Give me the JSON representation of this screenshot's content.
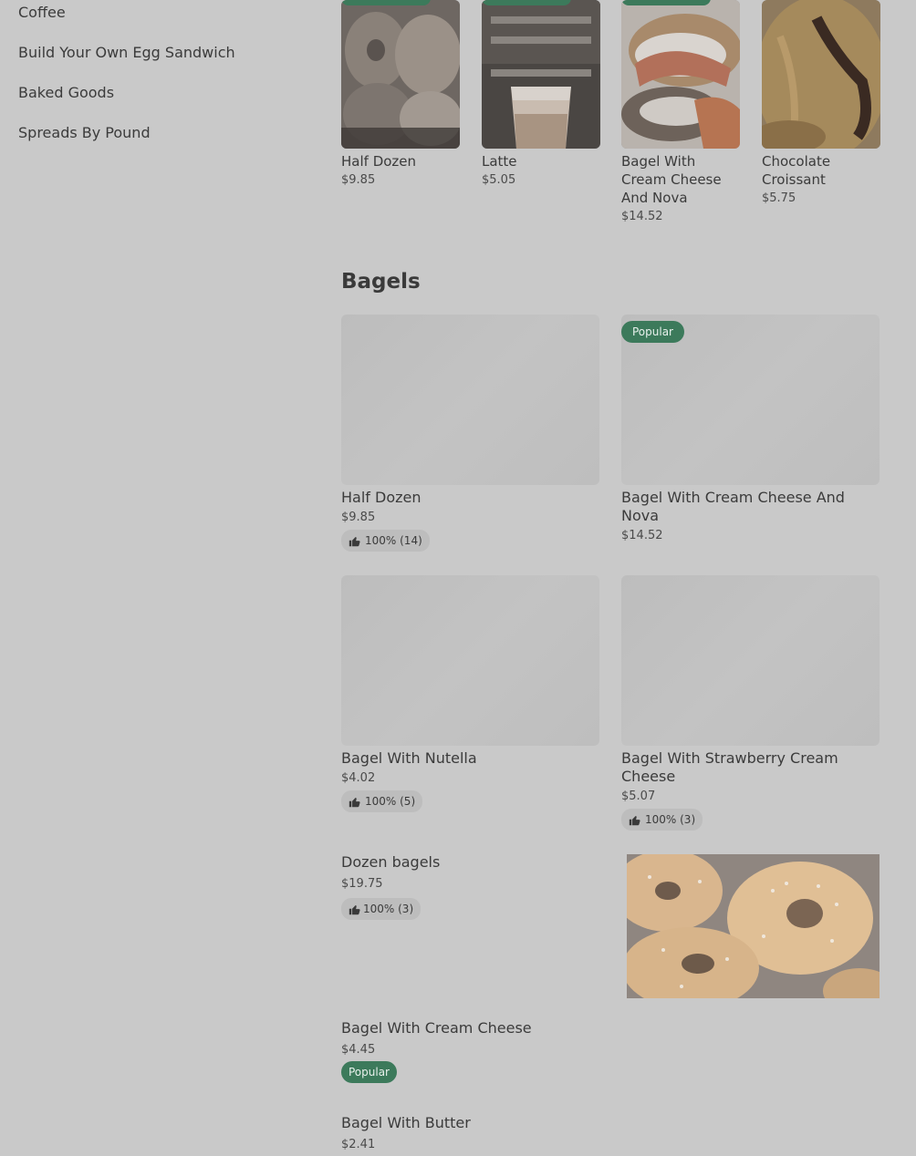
{
  "sidebar": {
    "items": [
      {
        "label": "Coffee"
      },
      {
        "label": "Build Your Own Egg Sandwich"
      },
      {
        "label": "Baked Goods"
      },
      {
        "label": "Spreads By Pound"
      }
    ]
  },
  "featured": [
    {
      "name": "Half Dozen",
      "price": "$9.85"
    },
    {
      "name": "Latte",
      "price": "$5.05"
    },
    {
      "name": "Bagel With Cream Cheese And Nova",
      "price": "$14.52"
    },
    {
      "name": "Chocolate Croissant",
      "price": "$5.75"
    }
  ],
  "section": {
    "title": "Bagels"
  },
  "grid": [
    {
      "name": "Half Dozen",
      "price": "$9.85",
      "rating": "100% (14)"
    },
    {
      "name": "Bagel With Cream Cheese  And Nova",
      "price": "$14.52",
      "badge": "Popular"
    },
    {
      "name": "Bagel With Nutella",
      "price": "$4.02",
      "rating": "100% (5)"
    },
    {
      "name": "Bagel With Strawberry Cream Cheese",
      "price": "$5.07",
      "rating": "100% (3)"
    }
  ],
  "list": [
    {
      "name": "Dozen bagels",
      "price": "$19.75",
      "rating": "100% (3)"
    },
    {
      "name": "Bagel With Cream Cheese",
      "price": "$4.45",
      "badge": "Popular"
    },
    {
      "name": "Bagel With Butter",
      "price": "$2.41"
    }
  ],
  "icons": {
    "rating": "thumbs-up-icon"
  },
  "colors": {
    "background": "#c9c9c9",
    "accent": "#3c7a5b"
  }
}
